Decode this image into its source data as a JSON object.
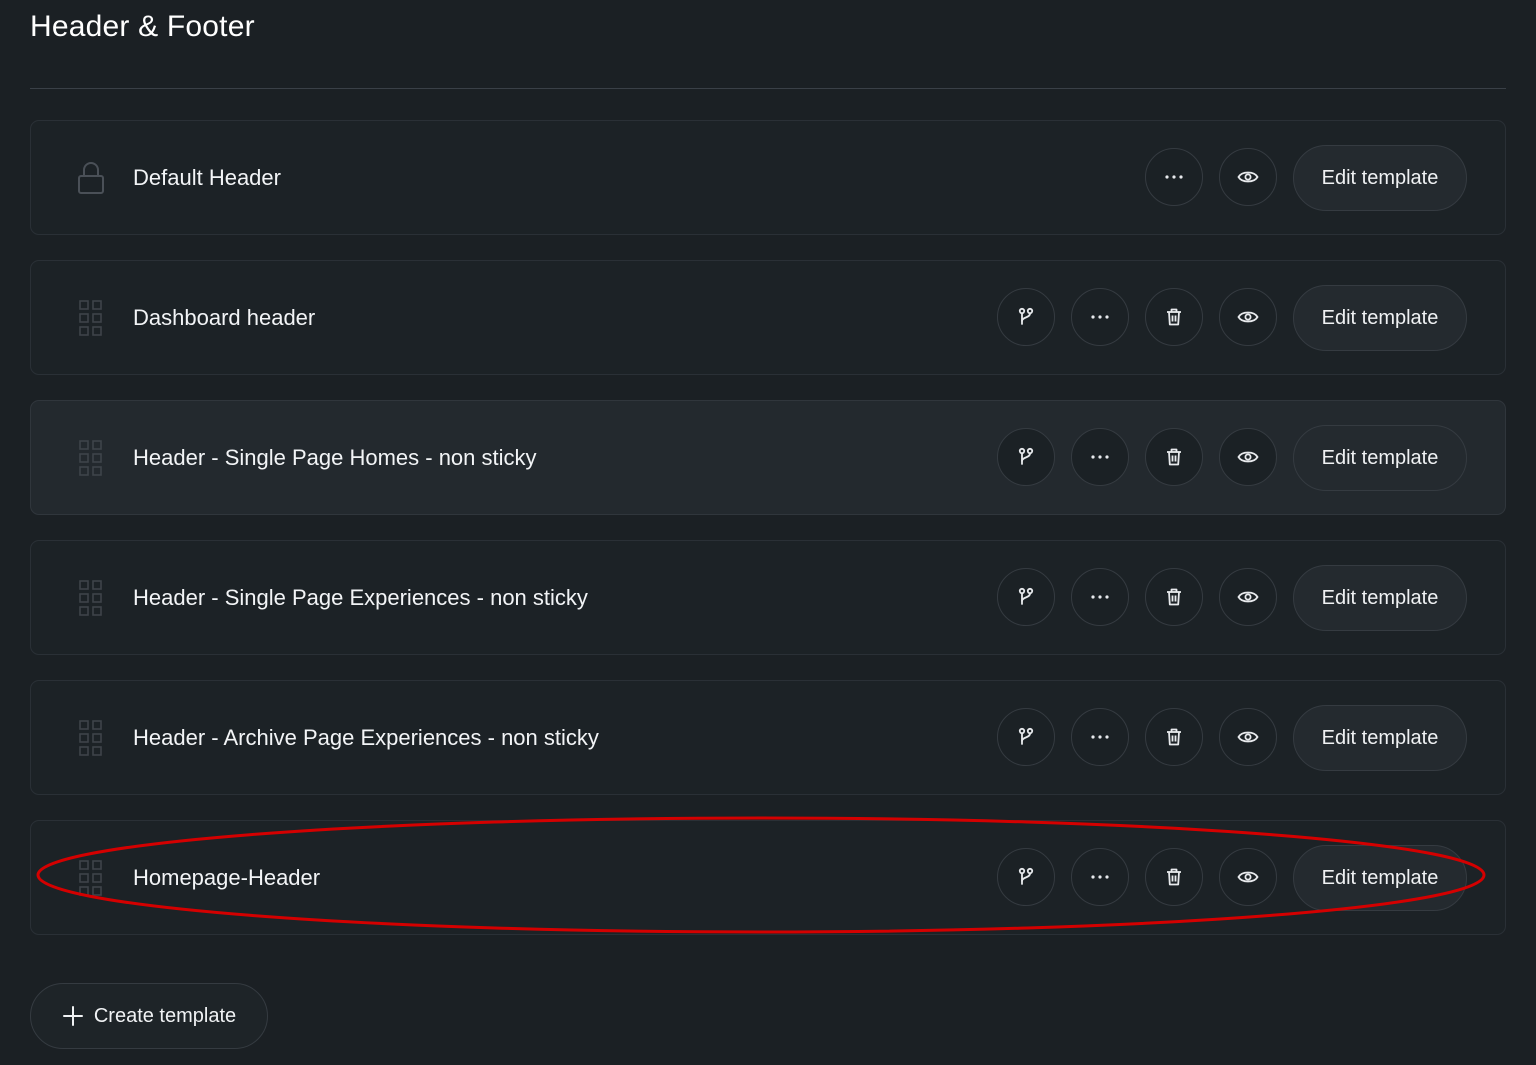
{
  "page": {
    "title": "Header & Footer"
  },
  "templates": [
    {
      "label": "Default Header",
      "locked": true,
      "icon": "lock-icon"
    },
    {
      "label": "Dashboard header",
      "locked": false,
      "icon": "drag-handle-icon"
    },
    {
      "label": "Header - Single Page Homes - non sticky",
      "locked": false,
      "icon": "drag-handle-icon",
      "hovered": true
    },
    {
      "label": "Header - Single Page Experiences - non sticky",
      "locked": false,
      "icon": "drag-handle-icon"
    },
    {
      "label": "Header - Archive Page Experiences - non sticky",
      "locked": false,
      "icon": "drag-handle-icon"
    },
    {
      "label": "Homepage-Header",
      "locked": false,
      "icon": "drag-handle-icon",
      "annotated": true
    }
  ],
  "actions": {
    "edit_label": "Edit template",
    "more_icon": "more-horizontal-icon",
    "preview_icon": "eye-icon",
    "delete_icon": "trash-icon",
    "conditions_icon": "branch-icon"
  },
  "footer": {
    "create_label": "Create template",
    "create_icon": "plus-icon"
  },
  "colors": {
    "background": "#1b2024",
    "row": "#1c2226",
    "row_hover": "#23292e",
    "annotation": "#d40000"
  }
}
